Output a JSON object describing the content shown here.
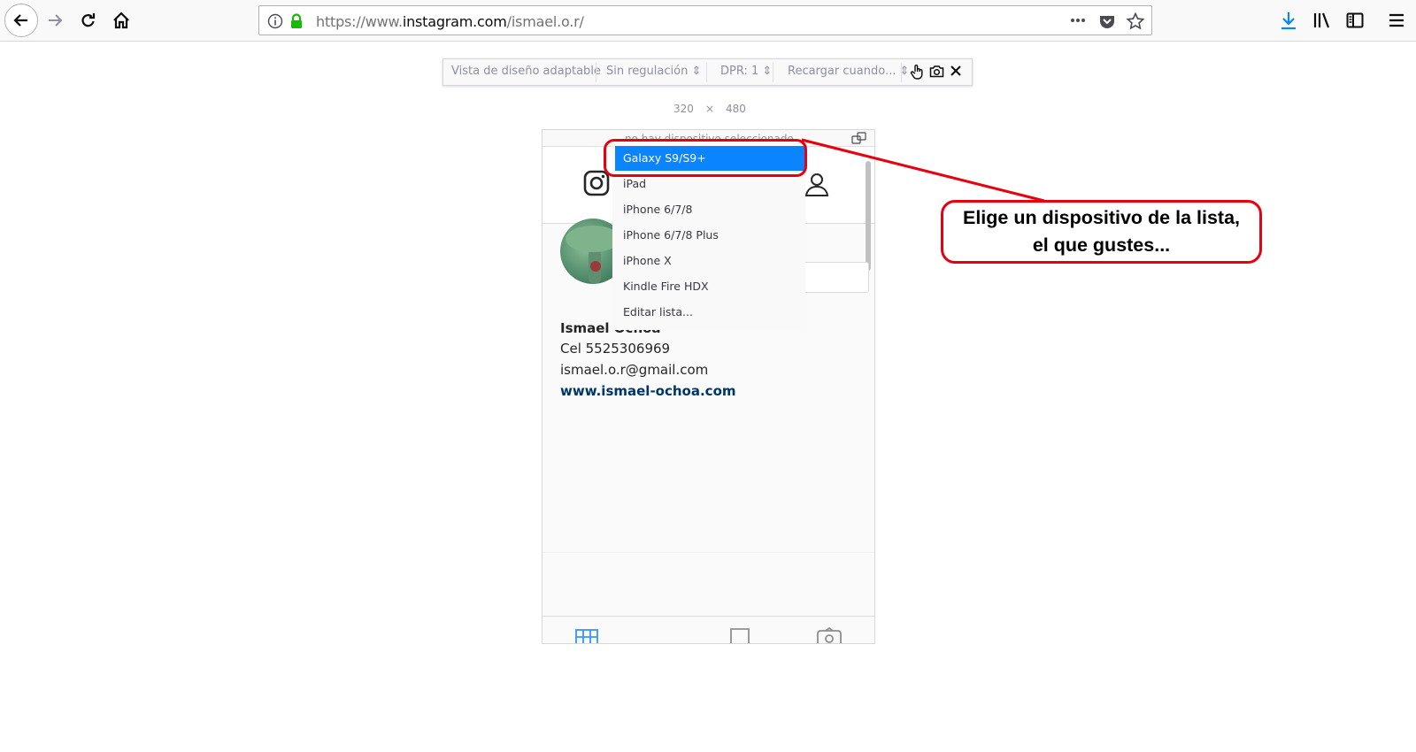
{
  "browser": {
    "url_prefix": "https://www.",
    "url_domain": "instagram.com",
    "url_path": "/ismael.o.r/",
    "back_icon": "arrow-left-icon",
    "forward_icon": "arrow-right-icon",
    "reload_icon": "reload-icon",
    "home_icon": "home-icon",
    "secure_icon": "lock-icon",
    "info_icon": "info-icon",
    "more_icon": "ellipsis-icon",
    "pocket_icon": "pocket-icon",
    "star_icon": "star-icon",
    "download_icon": "download-icon",
    "library_icon": "library-icon",
    "sidebar_icon": "sidebar-icon",
    "menu_icon": "hamburger-menu-icon"
  },
  "rdm": {
    "title": "Vista de diseño adaptable",
    "throttling": "Sin regulación",
    "dpr": "DPR: 1",
    "reload": "Recargar cuando...",
    "width": "320",
    "times": "×",
    "height": "480",
    "device_placeholder": "no hay dispositivo seleccionado"
  },
  "dropdown": {
    "items": [
      "Galaxy S9/S9+",
      "iPad",
      "iPhone 6/7/8",
      "iPhone 6/7/8 Plus",
      "iPhone X",
      "Kindle Fire HDX",
      "Editar lista..."
    ],
    "selected": "Galaxy S9/S9+"
  },
  "profile": {
    "name": "Ismael Ochoa",
    "phone": "Cel 5525306969",
    "email": "ismael.o.r@gmail.com",
    "website": "www.ismael-ochoa.com"
  },
  "callout": {
    "line1": "Elige un dispositivo de la lista,",
    "line2": "el que gustes..."
  },
  "colors": {
    "accent": "#0a84ff",
    "annotation": "#e8000d",
    "link": "#003569"
  }
}
